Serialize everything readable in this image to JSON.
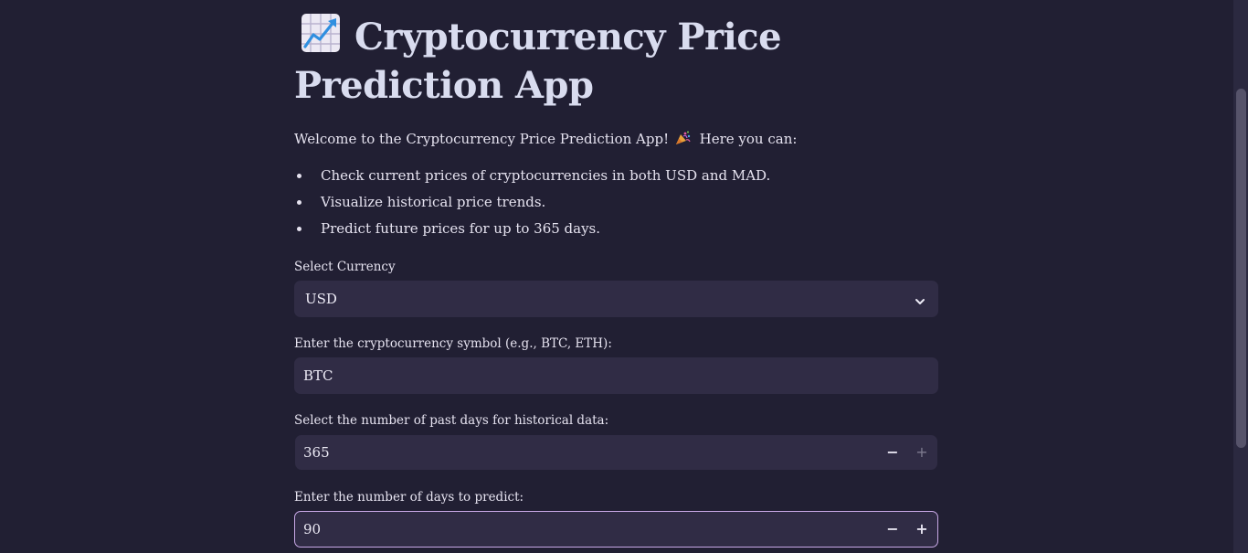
{
  "header": {
    "title": "Cryptocurrency Price Prediction App",
    "title_icon": "chart-increasing-icon"
  },
  "intro": {
    "text": "Welcome to the Cryptocurrency Price Prediction App!",
    "icon": "party-popper-icon",
    "suffix": "Here you can:"
  },
  "features": [
    "Check current prices of cryptocurrencies in both USD and MAD.",
    "Visualize historical price trends.",
    "Predict future prices for up to 365 days."
  ],
  "form": {
    "currency": {
      "label": "Select Currency",
      "value": "USD",
      "icon": "chevron-down-icon"
    },
    "symbol": {
      "label": "Enter the cryptocurrency symbol (e.g., BTC, ETH):",
      "value": "BTC"
    },
    "past_days": {
      "label": "Select the number of past days for historical data:",
      "value": "365",
      "minus": "−",
      "plus": "+"
    },
    "predict_days": {
      "label": "Enter the number of days to predict:",
      "value": "90",
      "minus": "−",
      "plus": "+"
    }
  },
  "colors": {
    "background": "#211f33",
    "input_background": "#302c45",
    "focus_border": "#c8a8e6",
    "text": "#e6e3f0",
    "title": "#d9dcef"
  }
}
